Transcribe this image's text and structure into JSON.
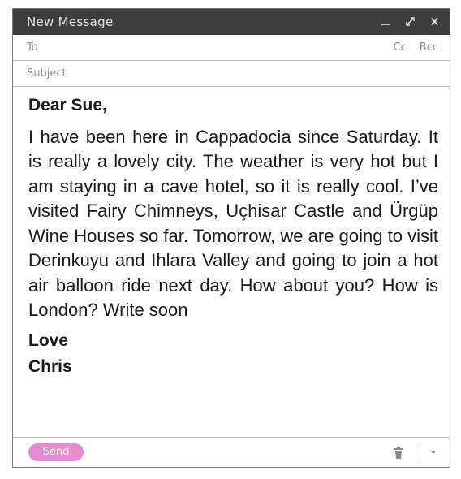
{
  "window": {
    "title": "New Message"
  },
  "fields": {
    "to_label": "To",
    "cc_label": "Cc",
    "bcc_label": "Bcc",
    "subject_label": "Subject"
  },
  "message": {
    "greeting": "Dear Sue,",
    "body": "I have been here in Cappadocia since Saturday. It is really a lovely city. The weather is very hot but I am staying in a cave hotel, so it is really cool. I’ve visited Fairy Chimneys, Uçhisar Castle and Ürgüp Wine Houses so far. Tomorrow, we are going to visit Derinkuyu and Ihlara Valley and going to join a hot air balloon ride next day. How about you? How is London? Write soon",
    "closing": "Love",
    "signature": "Chris"
  },
  "footer": {
    "send_label": "Send"
  },
  "icons": {
    "minimize": "minimize-icon",
    "expand": "expand-icon",
    "close": "close-icon",
    "trash": "trash-icon",
    "more": "chevron-down-icon"
  },
  "colors": {
    "titlebar": "#3d3d3d",
    "send_button": "#e58bd0"
  }
}
